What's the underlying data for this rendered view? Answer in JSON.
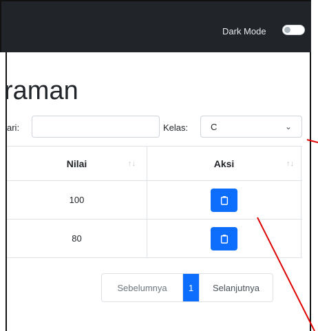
{
  "header": {
    "dark_mode_label": "Dark Mode"
  },
  "page": {
    "title": "raman"
  },
  "filters": {
    "search_label": "ari:",
    "search_value": "",
    "kelas_label": "Kelas:",
    "kelas_value": "C"
  },
  "table": {
    "columns": [
      {
        "label": "Nilai"
      },
      {
        "label": "Aksi"
      }
    ],
    "rows": [
      {
        "nilai": "100"
      },
      {
        "nilai": "80"
      }
    ]
  },
  "pagination": {
    "prev": "Sebelumnya",
    "current": "1",
    "next": "Selanjutnya"
  },
  "colors": {
    "navbar": "#212529",
    "primary": "#0d6efd",
    "annotation": "#e00000"
  },
  "icons": {
    "action": "clipboard-icon",
    "sort": "sort-icon",
    "select": "chevron-down-icon"
  }
}
